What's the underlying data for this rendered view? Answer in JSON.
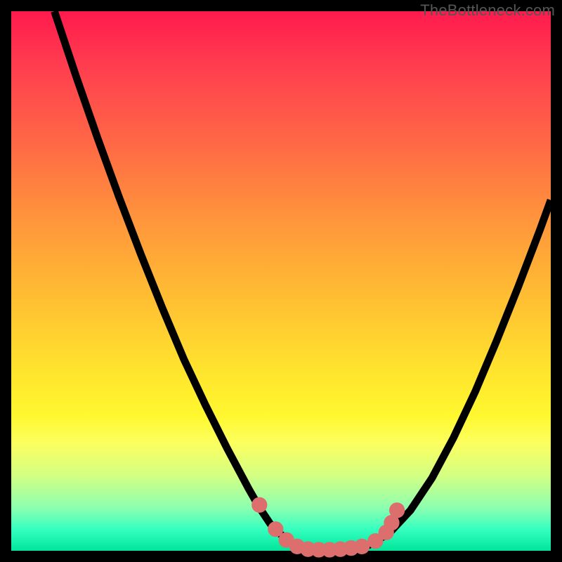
{
  "watermark": "TheBottleneck.com",
  "chart_data": {
    "type": "line",
    "title": "",
    "xlabel": "",
    "ylabel": "",
    "xlim": [
      0,
      100
    ],
    "ylim": [
      0,
      100
    ],
    "grid": false,
    "legend": false,
    "series": [
      {
        "name": "bottleneck-curve-left",
        "x": [
          8,
          12,
          16,
          20,
          24,
          28,
          32,
          36,
          40,
          44,
          46,
          48,
          50,
          52,
          54
        ],
        "y": [
          100,
          88,
          76.5,
          65.5,
          55,
          45,
          35.5,
          27,
          19,
          11.5,
          8,
          5,
          3,
          1.5,
          0.6
        ]
      },
      {
        "name": "bottleneck-curve-flat",
        "x": [
          54,
          56,
          58,
          60,
          62,
          64,
          66
        ],
        "y": [
          0.6,
          0.3,
          0.2,
          0.2,
          0.3,
          0.5,
          0.9
        ]
      },
      {
        "name": "bottleneck-curve-right",
        "x": [
          66,
          70,
          74,
          78,
          82,
          86,
          90,
          94,
          98,
          100
        ],
        "y": [
          0.9,
          3.2,
          7.5,
          13.5,
          21,
          29.5,
          39,
          49,
          59.5,
          65
        ]
      }
    ],
    "markers": {
      "name": "sample-dots",
      "color": "#dd6e6e",
      "points": [
        {
          "x": 46.0,
          "y": 8.5
        },
        {
          "x": 49.0,
          "y": 4.0
        },
        {
          "x": 51.0,
          "y": 2.0
        },
        {
          "x": 53.0,
          "y": 0.8
        },
        {
          "x": 55.0,
          "y": 0.3
        },
        {
          "x": 57.0,
          "y": 0.2
        },
        {
          "x": 59.0,
          "y": 0.2
        },
        {
          "x": 61.0,
          "y": 0.3
        },
        {
          "x": 63.0,
          "y": 0.5
        },
        {
          "x": 65.0,
          "y": 0.8
        },
        {
          "x": 67.5,
          "y": 1.8
        },
        {
          "x": 69.5,
          "y": 3.4
        },
        {
          "x": 70.5,
          "y": 5.2
        },
        {
          "x": 71.5,
          "y": 7.5
        }
      ]
    },
    "background_gradient": {
      "top": "#ff1a4d",
      "mid": "#ffe22e",
      "bottom": "#00e59a"
    }
  }
}
